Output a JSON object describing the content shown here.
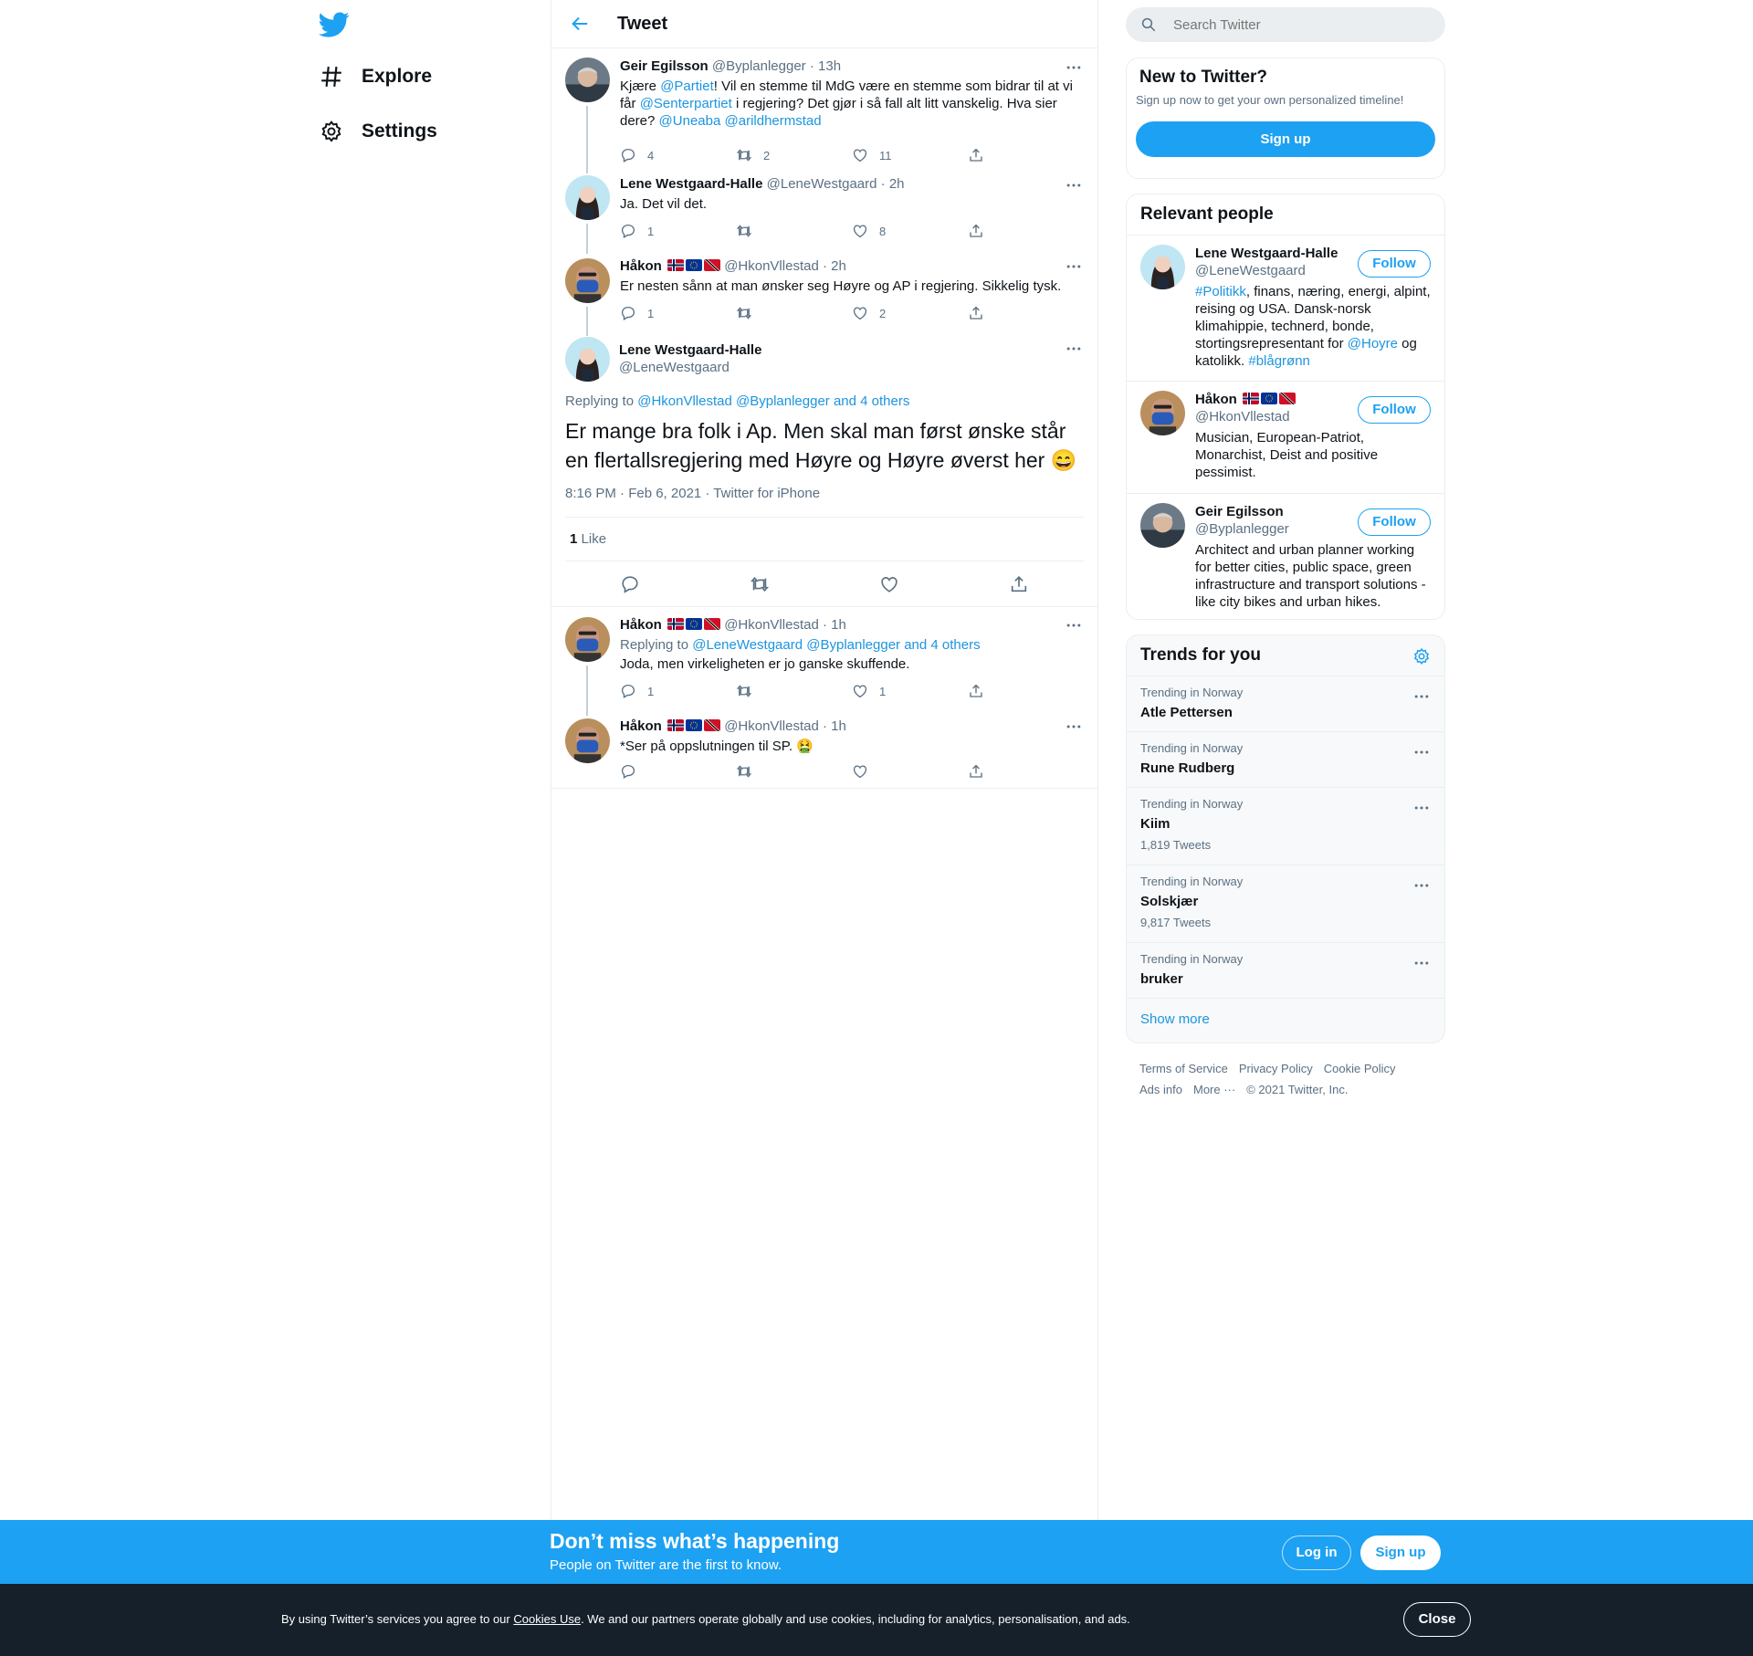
{
  "nav": {
    "explore": "Explore",
    "settings": "Settings"
  },
  "header": {
    "title": "Tweet"
  },
  "tweets": [
    {
      "name": "Geir Egilsson",
      "handle": "@Byplanlegger",
      "time": "· 13h",
      "t1": "Kjære ",
      "m1": "@Partiet",
      "t2": "! Vil en stemme til MdG være en stemme som bidrar til at vi får ",
      "m2": "@Senterpartiet",
      "t3": " i regjering? Det gjør i så fall alt litt vanskelig. Hva sier dere? ",
      "m3": "@Uneaba",
      "m4": "@arildhermstad",
      "replies": "4",
      "retweets": "2",
      "likes": "11"
    },
    {
      "name": "Lene Westgaard-Halle",
      "handle": "@LeneWestgaard",
      "time": "· 2h",
      "text": "Ja. Det vil det.",
      "replies": "1",
      "retweets": "",
      "likes": "8"
    },
    {
      "name": "Håkon",
      "handle": "@HkonVllestad",
      "time": "· 2h",
      "text": "Er nesten sånn at man ønsker seg Høyre og AP i regjering. Sikkelig tysk.",
      "replies": "1",
      "retweets": "",
      "likes": "2"
    }
  ],
  "focal": {
    "name": "Lene Westgaard-Halle",
    "handle": "@LeneWestgaard",
    "replying_label": "Replying to",
    "replying_to": "@HkonVllestad @Byplanlegger and 4 others",
    "text": "Er mange bra folk i Ap. Men skal man først ønske står en flertallsregjering med Høyre og Høyre øverst her",
    "emoji": "😄",
    "meta": "8:16 PM · Feb 6, 2021 · Twitter for iPhone",
    "likes_count": "1",
    "likes_label": "Like"
  },
  "replies": [
    {
      "name": "Håkon",
      "handle": "@HkonVllestad",
      "time": "· 1h",
      "replying_label": "Replying to",
      "replying_to": "@LeneWestgaard @Byplanlegger and 4 others",
      "text": "Joda, men virkeligheten er jo ganske skuffende.",
      "replies": "1",
      "retweets": "",
      "likes": "1"
    },
    {
      "name": "Håkon",
      "handle": "@HkonVllestad",
      "time": "· 1h",
      "text": "*Ser på oppslutningen til SP.",
      "emoji": "🤮",
      "replies": "",
      "retweets": "",
      "likes": ""
    }
  ],
  "search": {
    "placeholder": "Search Twitter"
  },
  "new_to_twitter": {
    "title": "New to Twitter?",
    "subtitle": "Sign up now to get your own personalized timeline!",
    "button": "Sign up"
  },
  "relevant": {
    "title": "Relevant people",
    "follow": "Follow",
    "people": [
      {
        "name": "Lene Westgaard-Halle",
        "handle": "@LeneWestgaard",
        "bio_tag1": "#Politikk",
        "bio_a": ", finans, næring, energi, alpint, reising og USA. Dansk-norsk klimahippie, technerd, bonde, stortingsrepresentant for ",
        "bio_tag2": "@Hoyre",
        "bio_b": " og katolikk. ",
        "bio_tag3": "#blågrønn"
      },
      {
        "name": "Håkon",
        "handle": "@HkonVllestad",
        "bio": "Musician, European-Patriot, Monarchist, Deist and positive pessimist."
      },
      {
        "name": "Geir Egilsson",
        "handle": "@Byplanlegger",
        "bio": "Architect and urban planner working for better cities, public space, green infrastructure and transport solutions - like city bikes and urban hikes."
      }
    ]
  },
  "trends": {
    "title": "Trends for you",
    "items": [
      {
        "context": "Trending in Norway",
        "name": "Atle Pettersen",
        "count": ""
      },
      {
        "context": "Trending in Norway",
        "name": "Rune Rudberg",
        "count": ""
      },
      {
        "context": "Trending in Norway",
        "name": "Kiim",
        "count": "1,819 Tweets"
      },
      {
        "context": "Trending in Norway",
        "name": "Solskjær",
        "count": "9,817 Tweets"
      },
      {
        "context": "Trending in Norway",
        "name": "bruker",
        "count": ""
      }
    ],
    "show_more": "Show more"
  },
  "footer": {
    "terms": "Terms of Service",
    "privacy": "Privacy Policy",
    "cookie": "Cookie Policy",
    "ads": "Ads info",
    "more": "More ···",
    "copyright": "© 2021 Twitter, Inc."
  },
  "banner": {
    "title": "Don’t miss what’s happening",
    "subtitle": "People on Twitter are the first to know.",
    "login": "Log in",
    "signup": "Sign up"
  },
  "cookie": {
    "text_a": "By using Twitter’s services you agree to our ",
    "link": "Cookies Use",
    "text_b": ". We and our partners operate globally and use cookies, including for analytics, personalisation, and ads.",
    "close": "Close"
  },
  "colors": {
    "accent": "#1da1f2",
    "link": "#1b95e0",
    "banner": "#1da1f2",
    "cookie_bg": "#15202b"
  }
}
